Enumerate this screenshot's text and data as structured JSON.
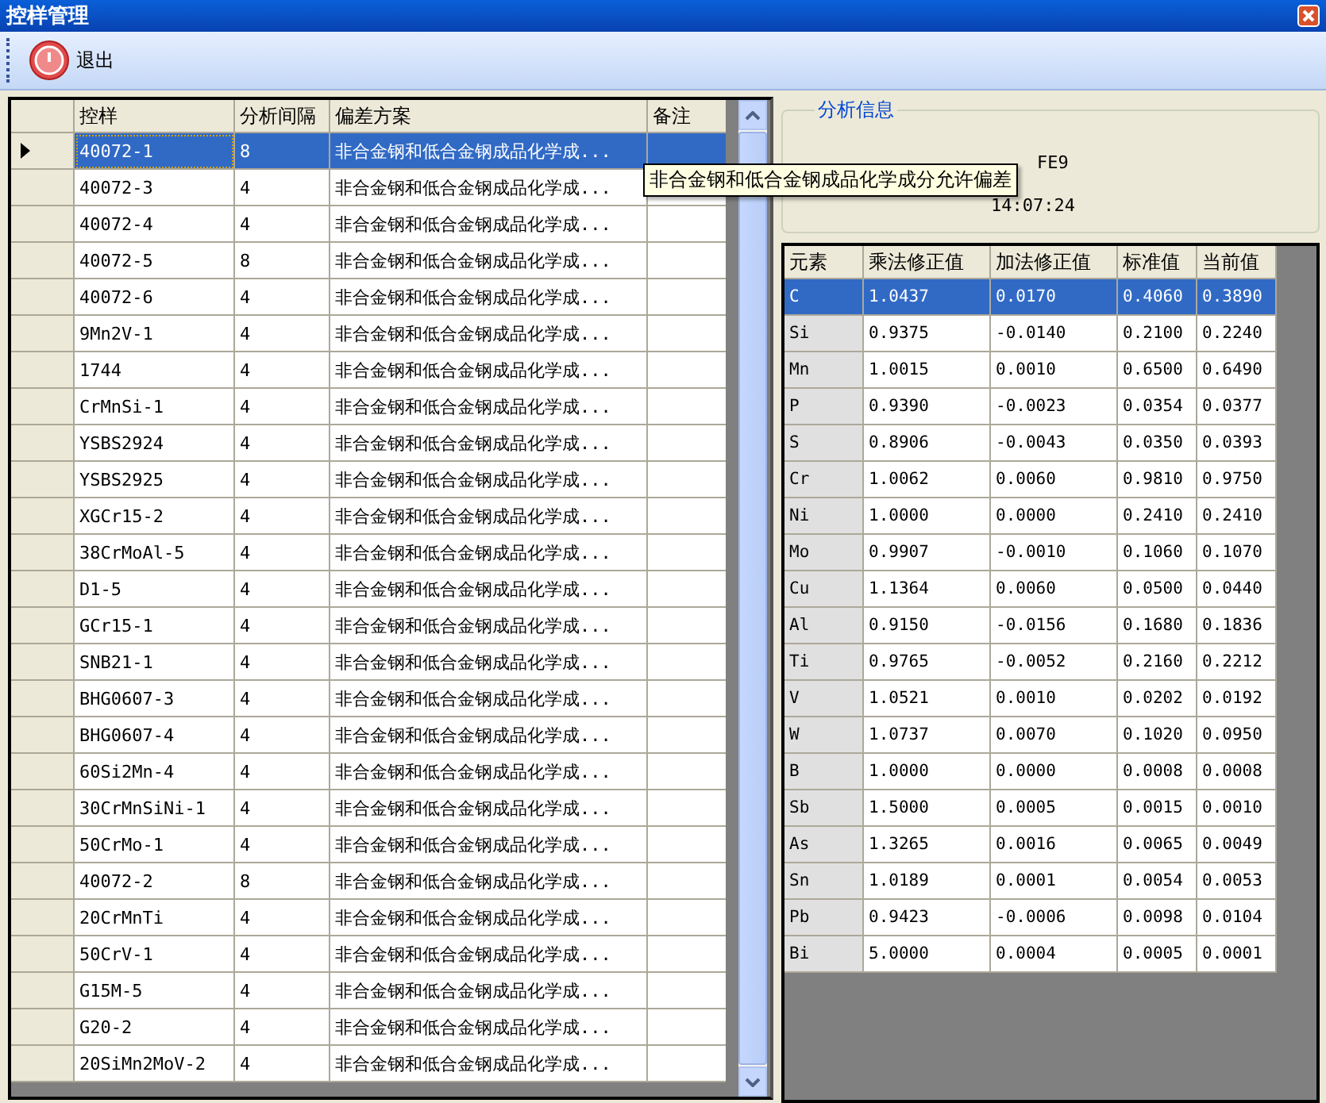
{
  "window": {
    "title": "控样管理"
  },
  "toolbar": {
    "exit_label": "退出"
  },
  "sample_table": {
    "columns": [
      "控样",
      "分析间隔",
      "偏差方案",
      "备注"
    ],
    "rows": [
      {
        "sample": "40072-1",
        "interval": "8",
        "scheme": "非合金钢和低合金钢成品化学成...",
        "selected": true
      },
      {
        "sample": "40072-3",
        "interval": "4",
        "scheme": "非合金钢和低合金钢成品化学成...",
        "selected": false
      },
      {
        "sample": "40072-4",
        "interval": "4",
        "scheme": "非合金钢和低合金钢成品化学成...",
        "selected": false
      },
      {
        "sample": "40072-5",
        "interval": "8",
        "scheme": "非合金钢和低合金钢成品化学成...",
        "selected": false
      },
      {
        "sample": "40072-6",
        "interval": "4",
        "scheme": "非合金钢和低合金钢成品化学成...",
        "selected": false
      },
      {
        "sample": "9Mn2V-1",
        "interval": "4",
        "scheme": "非合金钢和低合金钢成品化学成...",
        "selected": false
      },
      {
        "sample": "1744",
        "interval": "4",
        "scheme": "非合金钢和低合金钢成品化学成...",
        "selected": false
      },
      {
        "sample": "CrMnSi-1",
        "interval": "4",
        "scheme": "非合金钢和低合金钢成品化学成...",
        "selected": false
      },
      {
        "sample": "YSBS2924",
        "interval": "4",
        "scheme": "非合金钢和低合金钢成品化学成...",
        "selected": false
      },
      {
        "sample": "YSBS2925",
        "interval": "4",
        "scheme": "非合金钢和低合金钢成品化学成...",
        "selected": false
      },
      {
        "sample": "XGCr15-2",
        "interval": "4",
        "scheme": "非合金钢和低合金钢成品化学成...",
        "selected": false
      },
      {
        "sample": "38CrMoAl-5",
        "interval": "4",
        "scheme": "非合金钢和低合金钢成品化学成...",
        "selected": false
      },
      {
        "sample": "D1-5",
        "interval": "4",
        "scheme": "非合金钢和低合金钢成品化学成...",
        "selected": false
      },
      {
        "sample": "GCr15-1",
        "interval": "4",
        "scheme": "非合金钢和低合金钢成品化学成...",
        "selected": false
      },
      {
        "sample": "SNB21-1",
        "interval": "4",
        "scheme": "非合金钢和低合金钢成品化学成...",
        "selected": false
      },
      {
        "sample": "BHG0607-3",
        "interval": "4",
        "scheme": "非合金钢和低合金钢成品化学成...",
        "selected": false
      },
      {
        "sample": "BHG0607-4",
        "interval": "4",
        "scheme": "非合金钢和低合金钢成品化学成...",
        "selected": false
      },
      {
        "sample": "60Si2Mn-4",
        "interval": "4",
        "scheme": "非合金钢和低合金钢成品化学成...",
        "selected": false
      },
      {
        "sample": "30CrMnSiNi-1",
        "interval": "4",
        "scheme": "非合金钢和低合金钢成品化学成...",
        "selected": false
      },
      {
        "sample": "50CrMo-1",
        "interval": "4",
        "scheme": "非合金钢和低合金钢成品化学成...",
        "selected": false
      },
      {
        "sample": "40072-2",
        "interval": "8",
        "scheme": "非合金钢和低合金钢成品化学成...",
        "selected": false
      },
      {
        "sample": "20CrMnTi",
        "interval": "4",
        "scheme": "非合金钢和低合金钢成品化学成...",
        "selected": false
      },
      {
        "sample": "50CrV-1",
        "interval": "4",
        "scheme": "非合金钢和低合金钢成品化学成...",
        "selected": false
      },
      {
        "sample": "G15M-5",
        "interval": "4",
        "scheme": "非合金钢和低合金钢成品化学成...",
        "selected": false
      },
      {
        "sample": "G20-2",
        "interval": "4",
        "scheme": "非合金钢和低合金钢成品化学成...",
        "selected": false
      },
      {
        "sample": "20SiMn2MoV-2",
        "interval": "4",
        "scheme": "非合金钢和低合金钢成品化学成...",
        "selected": false
      }
    ]
  },
  "tooltip": "非合金钢和低合金钢成品化学成分允许偏差",
  "analysis_info": {
    "title": "分析信息",
    "program": "FE9",
    "time": "14:07:24"
  },
  "element_table": {
    "columns": [
      "元素",
      "乘法修正值",
      "加法修正值",
      "标准值",
      "当前值"
    ],
    "rows": [
      {
        "cells": [
          "C",
          "1.0437",
          "0.0170",
          "0.4060",
          "0.3890"
        ],
        "selected": true
      },
      {
        "cells": [
          "Si",
          "0.9375",
          "-0.0140",
          "0.2100",
          "0.2240"
        ],
        "selected": false
      },
      {
        "cells": [
          "Mn",
          "1.0015",
          "0.0010",
          "0.6500",
          "0.6490"
        ],
        "selected": false
      },
      {
        "cells": [
          "P",
          "0.9390",
          "-0.0023",
          "0.0354",
          "0.0377"
        ],
        "selected": false
      },
      {
        "cells": [
          "S",
          "0.8906",
          "-0.0043",
          "0.0350",
          "0.0393"
        ],
        "selected": false
      },
      {
        "cells": [
          "Cr",
          "1.0062",
          "0.0060",
          "0.9810",
          "0.9750"
        ],
        "selected": false
      },
      {
        "cells": [
          "Ni",
          "1.0000",
          "0.0000",
          "0.2410",
          "0.2410"
        ],
        "selected": false
      },
      {
        "cells": [
          "Mo",
          "0.9907",
          "-0.0010",
          "0.1060",
          "0.1070"
        ],
        "selected": false
      },
      {
        "cells": [
          "Cu",
          "1.1364",
          "0.0060",
          "0.0500",
          "0.0440"
        ],
        "selected": false
      },
      {
        "cells": [
          "Al",
          "0.9150",
          "-0.0156",
          "0.1680",
          "0.1836"
        ],
        "selected": false
      },
      {
        "cells": [
          "Ti",
          "0.9765",
          "-0.0052",
          "0.2160",
          "0.2212"
        ],
        "selected": false
      },
      {
        "cells": [
          "V",
          "1.0521",
          "0.0010",
          "0.0202",
          "0.0192"
        ],
        "selected": false
      },
      {
        "cells": [
          "W",
          "1.0737",
          "0.0070",
          "0.1020",
          "0.0950"
        ],
        "selected": false
      },
      {
        "cells": [
          "B",
          "1.0000",
          "0.0000",
          "0.0008",
          "0.0008"
        ],
        "selected": false
      },
      {
        "cells": [
          "Sb",
          "1.5000",
          "0.0005",
          "0.0015",
          "0.0010"
        ],
        "selected": false
      },
      {
        "cells": [
          "As",
          "1.3265",
          "0.0016",
          "0.0065",
          "0.0049"
        ],
        "selected": false
      },
      {
        "cells": [
          "Sn",
          "1.0189",
          "0.0001",
          "0.0054",
          "0.0053"
        ],
        "selected": false
      },
      {
        "cells": [
          "Pb",
          "0.9423",
          "-0.0006",
          "0.0098",
          "0.0104"
        ],
        "selected": false
      },
      {
        "cells": [
          "Bi",
          "5.0000",
          "0.0004",
          "0.0005",
          "0.0001"
        ],
        "selected": false
      }
    ]
  }
}
